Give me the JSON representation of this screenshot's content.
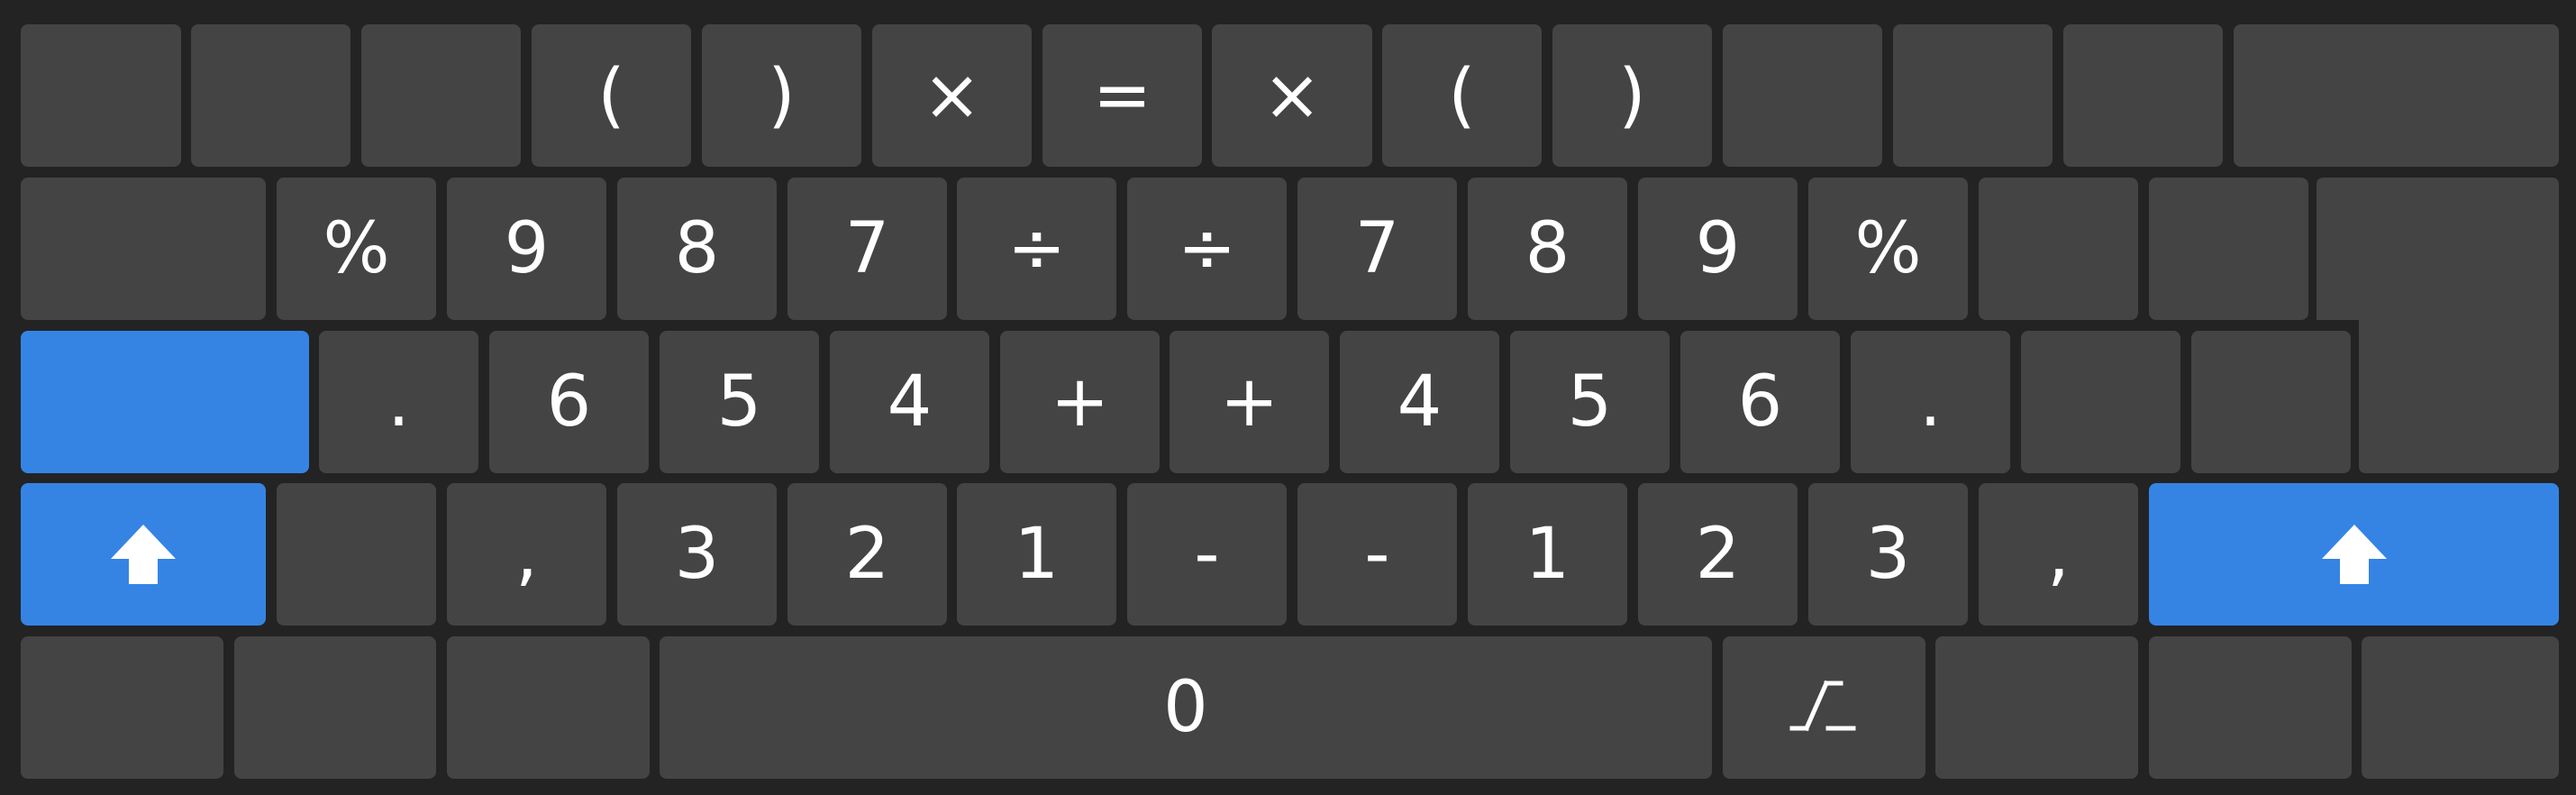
{
  "keyboard": {
    "layout": "numeric-symbols, mirrored split",
    "colors": {
      "background": "#232323",
      "key": "#444444",
      "accent": "#3584e4",
      "text": "#ffffff"
    },
    "row1": [
      "",
      "",
      "",
      "(",
      ")",
      "×",
      "=",
      "×",
      "(",
      ")",
      "",
      "",
      "",
      ""
    ],
    "row2": [
      "",
      "%",
      "9",
      "8",
      "7",
      "÷",
      "÷",
      "7",
      "8",
      "9",
      "%",
      "",
      ""
    ],
    "row3": [
      "",
      ".",
      "6",
      "5",
      "4",
      "+",
      "+",
      "4",
      "5",
      "6",
      ".",
      "",
      ""
    ],
    "row4": [
      "",
      ",",
      "3",
      "2",
      "1",
      "-",
      "-",
      "1",
      "2",
      "3",
      ","
    ],
    "row5": [
      "",
      "",
      "",
      "0",
      "",
      "",
      "",
      ""
    ],
    "icons": {
      "shift_left": "shift-arrow-up-icon",
      "shift_right": "shift-arrow-up-icon",
      "layout_switch": "layout-switch-icon"
    }
  }
}
